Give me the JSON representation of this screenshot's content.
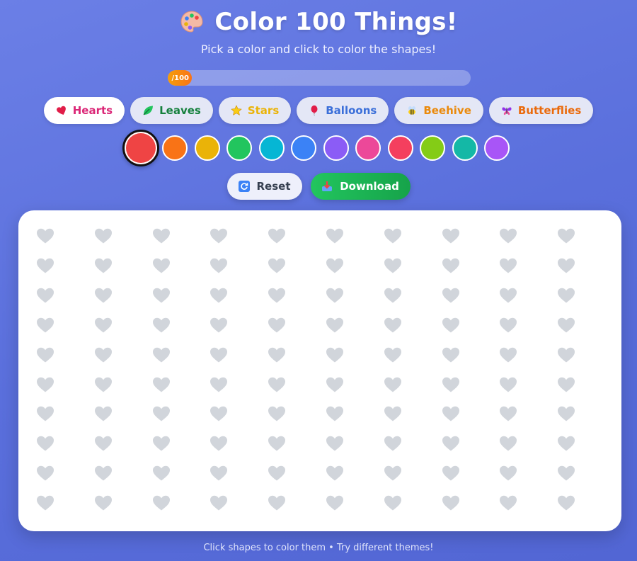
{
  "header": {
    "title": "Color 100 Things!",
    "subtitle": "Pick a color and click to color the shapes!",
    "title_icon": "artist-palette-icon"
  },
  "progress": {
    "text": "/100",
    "colored": 0,
    "total": 100,
    "fill_color": "#f59e0b"
  },
  "themes": [
    {
      "label": "Hearts",
      "icon": "heart-icon",
      "color": "#db2777",
      "active": true
    },
    {
      "label": "Leaves",
      "icon": "leaf-icon",
      "color": "#15803d",
      "active": false
    },
    {
      "label": "Stars",
      "icon": "star-icon",
      "color": "#eab308",
      "active": false
    },
    {
      "label": "Balloons",
      "icon": "balloon-icon",
      "color": "#3b6fd9",
      "active": false
    },
    {
      "label": "Beehive",
      "icon": "bee-icon",
      "color": "#ea8a0c",
      "active": false
    },
    {
      "label": "Butterflies",
      "icon": "butterfly-icon",
      "color": "#ea6a0c",
      "active": false
    }
  ],
  "palette": {
    "selected_index": 0,
    "colors": [
      "#ef4444",
      "#f97316",
      "#eab308",
      "#22c55e",
      "#06b6d4",
      "#3b82f6",
      "#8b5cf6",
      "#ec4899",
      "#f43f5e",
      "#84cc16",
      "#14b8a6",
      "#a855f7"
    ]
  },
  "actions": {
    "reset_label": "Reset",
    "reset_icon": "refresh-icon",
    "download_label": "Download",
    "download_icon": "download-icon"
  },
  "canvas": {
    "shape": "heart",
    "rows": 10,
    "cols": 10,
    "uncolored_color": "#d1d5db"
  },
  "footer": {
    "text": "Click shapes to color them • Try different themes!"
  }
}
